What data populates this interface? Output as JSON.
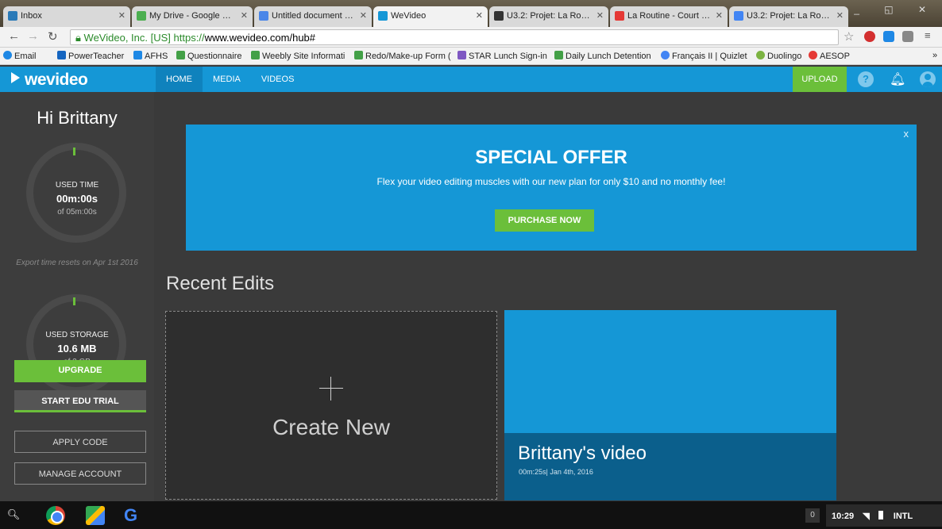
{
  "browser": {
    "tabs": [
      {
        "title": "Inbox",
        "favicon_color": "#2a7ab8"
      },
      {
        "title": "My Drive - Google Driv",
        "favicon_color": "#4caf50"
      },
      {
        "title": "Untitled document - Go",
        "favicon_color": "#4a86e8"
      },
      {
        "title": "WeVideo",
        "favicon_color": "#1597d6"
      },
      {
        "title": "U3.2: Projet: La Routin",
        "favicon_color": "#333333"
      },
      {
        "title": "La Routine - Court Mé",
        "favicon_color": "#e53935"
      },
      {
        "title": "U3.2: Projet: La Routin",
        "favicon_color": "#4285f4"
      }
    ],
    "site_identity": "WeVideo, Inc. [US]",
    "url_protocol": "https://",
    "url_rest": "www.wevideo.com/hub#",
    "bookmarks": [
      "Email",
      "PowerTeacher",
      "AFHS",
      "Questionnaire",
      "Weebly Site Informati",
      "Redo/Make-up Form (",
      "STAR Lunch Sign-in",
      "Daily Lunch Detention",
      "Français II | Quizlet",
      "Duolingo",
      "AESOP"
    ]
  },
  "header": {
    "logo": "wevideo",
    "nav": [
      "HOME",
      "MEDIA",
      "VIDEOS"
    ],
    "upload_label": "UPLOAD",
    "help_glyph": "?"
  },
  "sidebar": {
    "greeting": "Hi Brittany",
    "time": {
      "label": "USED TIME",
      "value": "00m:00s",
      "of": "of 05m:00s"
    },
    "reset_note": "Export time resets on Apr 1st 2016",
    "storage": {
      "label": "USED STORAGE",
      "value": "10.6 MB",
      "of": "of 2 GB"
    },
    "buttons": {
      "upgrade": "UPGRADE",
      "edu_trial": "START EDU TRIAL",
      "apply_code": "APPLY CODE",
      "manage_account": "MANAGE ACCOUNT"
    }
  },
  "offer": {
    "close": "x",
    "title": "SPECIAL OFFER",
    "text": "Flex your video editing muscles with our new plan for only $10 and no monthly fee!",
    "button": "PURCHASE NOW"
  },
  "recent": {
    "title": "Recent Edits",
    "create_label": "Create New",
    "video": {
      "title": "Brittany's video",
      "meta": "00m:25s| Jan 4th, 2016"
    }
  },
  "shelf": {
    "notification_count": "0",
    "time": "10:29",
    "ime": "INTL"
  },
  "colors": {
    "brand_blue": "#1597d6",
    "accent_green": "#6bbf3a",
    "sidebar_bg": "#3d3d3d"
  }
}
